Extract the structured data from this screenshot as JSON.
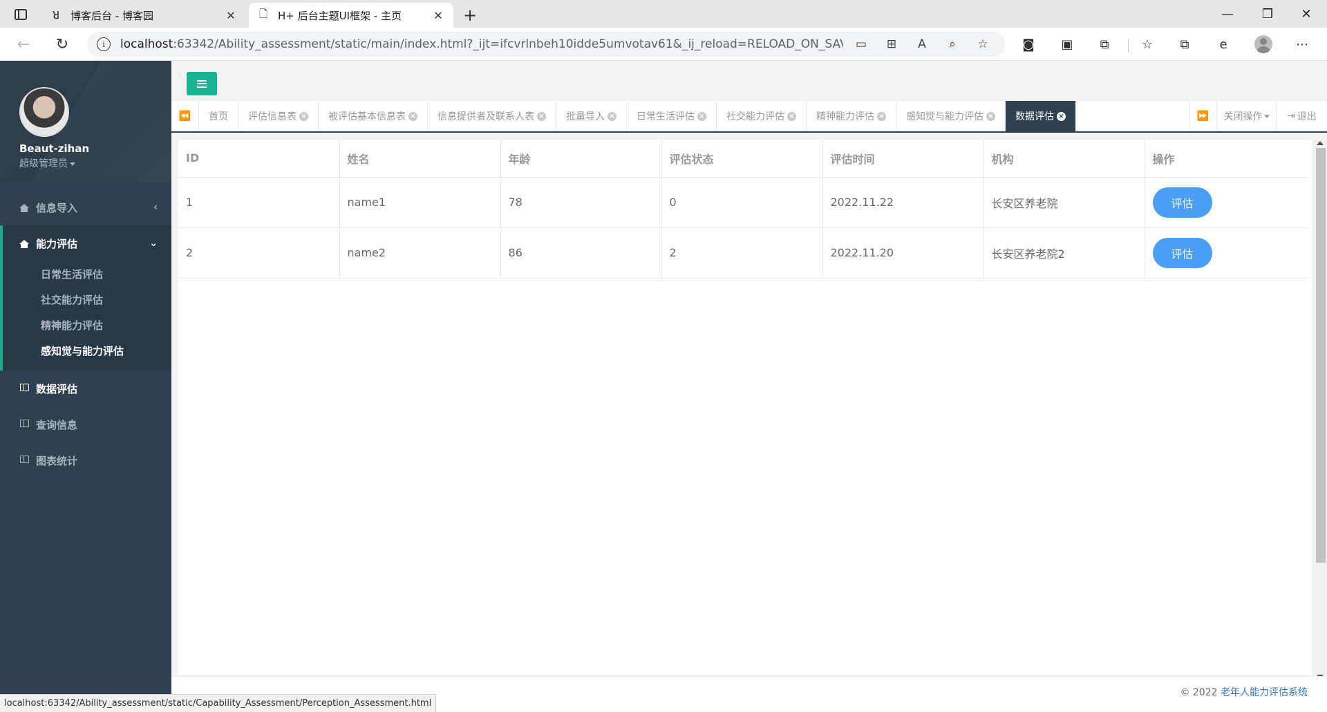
{
  "browser": {
    "tabs": [
      {
        "title": "博客后台 - 博客园",
        "icon": "cnblogs-icon",
        "active": false
      },
      {
        "title": "H+ 后台主题UI框架 - 主页",
        "icon": "page-icon",
        "active": true
      }
    ],
    "url_host": "localhost",
    "url_rest": ":63342/Ability_assessment/static/main/index.html?_ijt=ifcvrlnbeh10idde5umvotav61&_ij_reload=RELOAD_ON_SAVE",
    "status_url": "localhost:63342/Ability_assessment/static/Capability_Assessment/Perception_Assessment.html"
  },
  "sidebar": {
    "user_name": "Beaut-zihan",
    "user_role": "超级管理员",
    "menu": {
      "info_import": "信息导入",
      "ability_eval": "能力评估",
      "sub": [
        "日常生活评估",
        "社交能力评估",
        "精神能力评估",
        "感知觉与能力评估"
      ],
      "data_eval": "数据评估",
      "query_info": "查询信息",
      "chart_stats": "图表统计"
    }
  },
  "page_tabs": {
    "items": [
      "首页",
      "评估信息表",
      "被评估基本信息表",
      "信息提供者及联系人表",
      "批量导入",
      "日常生活评估",
      "社交能力评估",
      "精神能力评估",
      "感知觉与能力评估",
      "数据评估"
    ],
    "active_index": 9,
    "close_ops": "关闭操作",
    "logout": "退出"
  },
  "table": {
    "headers": [
      "ID",
      "姓名",
      "年龄",
      "评估状态",
      "评估时间",
      "机构",
      "操作"
    ],
    "rows": [
      {
        "id": "1",
        "name": "name1",
        "age": "78",
        "status": "0",
        "time": "2022.11.22",
        "org": "长安区养老院",
        "action": "评估"
      },
      {
        "id": "2",
        "name": "name2",
        "age": "86",
        "status": "2",
        "time": "2022.11.20",
        "org": "长安区养老院2",
        "action": "评估"
      }
    ]
  },
  "footer": {
    "prefix": "© 2022",
    "link": "老年人能力评估系统"
  },
  "colors": {
    "sidebar_bg": "#2f4050",
    "accent_green": "#1ab394",
    "button_blue": "#4a9ff5"
  }
}
